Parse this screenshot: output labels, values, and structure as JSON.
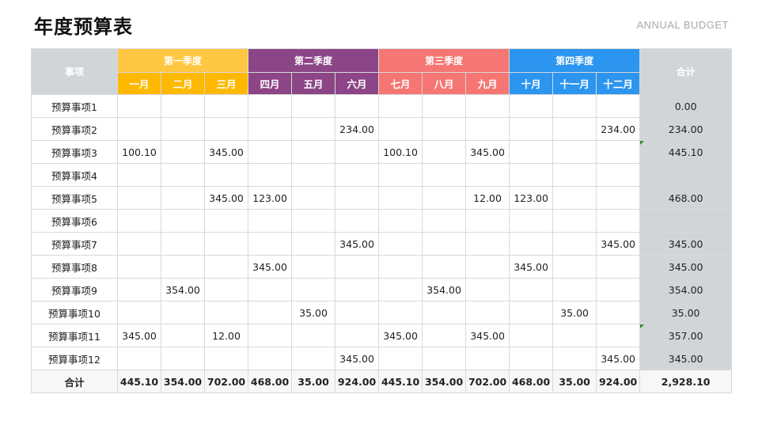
{
  "header": {
    "title": "年度预算表",
    "subtitle": "ANNUAL BUDGET"
  },
  "colors": {
    "q1": "#ffc741",
    "q1_month": "#ffb800",
    "q2": "#8c4587",
    "q2_month": "#8c4587",
    "q3": "#f57672",
    "q3_month": "#f57672",
    "q4": "#2b95ef",
    "q4_month": "#2b95ef",
    "summary_bg": "#d0d6d8"
  },
  "table": {
    "item_header": "事项",
    "total_header": "合计",
    "quarters": [
      "第一季度",
      "第二季度",
      "第三季度",
      "第四季度"
    ],
    "months": [
      "一月",
      "二月",
      "三月",
      "四月",
      "五月",
      "六月",
      "七月",
      "八月",
      "九月",
      "十月",
      "十一月",
      "十二月"
    ],
    "rows": [
      {
        "name": "预算事项1",
        "values": [
          "",
          "",
          "",
          "",
          "",
          "",
          "",
          "",
          "",
          "",
          "",
          ""
        ],
        "total": "0.00",
        "flag": false
      },
      {
        "name": "预算事项2",
        "values": [
          "",
          "",
          "",
          "",
          "",
          "234.00",
          "",
          "",
          "",
          "",
          "",
          "234.00"
        ],
        "total": "234.00",
        "flag": false
      },
      {
        "name": "预算事项3",
        "values": [
          "100.10",
          "",
          "345.00",
          "",
          "",
          "",
          "100.10",
          "",
          "345.00",
          "",
          "",
          ""
        ],
        "total": "445.10",
        "flag": true
      },
      {
        "name": "预算事项4",
        "values": [
          "",
          "",
          "",
          "",
          "",
          "",
          "",
          "",
          "",
          "",
          "",
          ""
        ],
        "total": "",
        "flag": false
      },
      {
        "name": "预算事项5",
        "values": [
          "",
          "",
          "345.00",
          "123.00",
          "",
          "",
          "",
          "",
          "12.00",
          "123.00",
          "",
          ""
        ],
        "total": "468.00",
        "flag": false
      },
      {
        "name": "预算事项6",
        "values": [
          "",
          "",
          "",
          "",
          "",
          "",
          "",
          "",
          "",
          "",
          "",
          ""
        ],
        "total": "",
        "flag": false
      },
      {
        "name": "预算事项7",
        "values": [
          "",
          "",
          "",
          "",
          "",
          "345.00",
          "",
          "",
          "",
          "",
          "",
          "345.00"
        ],
        "total": "345.00",
        "flag": false
      },
      {
        "name": "预算事项8",
        "values": [
          "",
          "",
          "",
          "345.00",
          "",
          "",
          "",
          "",
          "",
          "345.00",
          "",
          ""
        ],
        "total": "345.00",
        "flag": false
      },
      {
        "name": "预算事项9",
        "values": [
          "",
          "354.00",
          "",
          "",
          "",
          "",
          "",
          "354.00",
          "",
          "",
          "",
          ""
        ],
        "total": "354.00",
        "flag": false
      },
      {
        "name": "预算事项10",
        "values": [
          "",
          "",
          "",
          "",
          "35.00",
          "",
          "",
          "",
          "",
          "",
          "35.00",
          ""
        ],
        "total": "35.00",
        "flag": false
      },
      {
        "name": "预算事项11",
        "values": [
          "345.00",
          "",
          "12.00",
          "",
          "",
          "",
          "345.00",
          "",
          "345.00",
          "",
          "",
          ""
        ],
        "total": "357.00",
        "flag": true
      },
      {
        "name": "预算事项12",
        "values": [
          "",
          "",
          "",
          "",
          "",
          "345.00",
          "",
          "",
          "",
          "",
          "",
          "345.00"
        ],
        "total": "345.00",
        "flag": false
      }
    ],
    "sum_row": {
      "label": "合计",
      "values": [
        "445.10",
        "354.00",
        "702.00",
        "468.00",
        "35.00",
        "924.00",
        "445.10",
        "354.00",
        "702.00",
        "468.00",
        "35.00",
        "924.00"
      ],
      "total": "2,928.10"
    }
  }
}
